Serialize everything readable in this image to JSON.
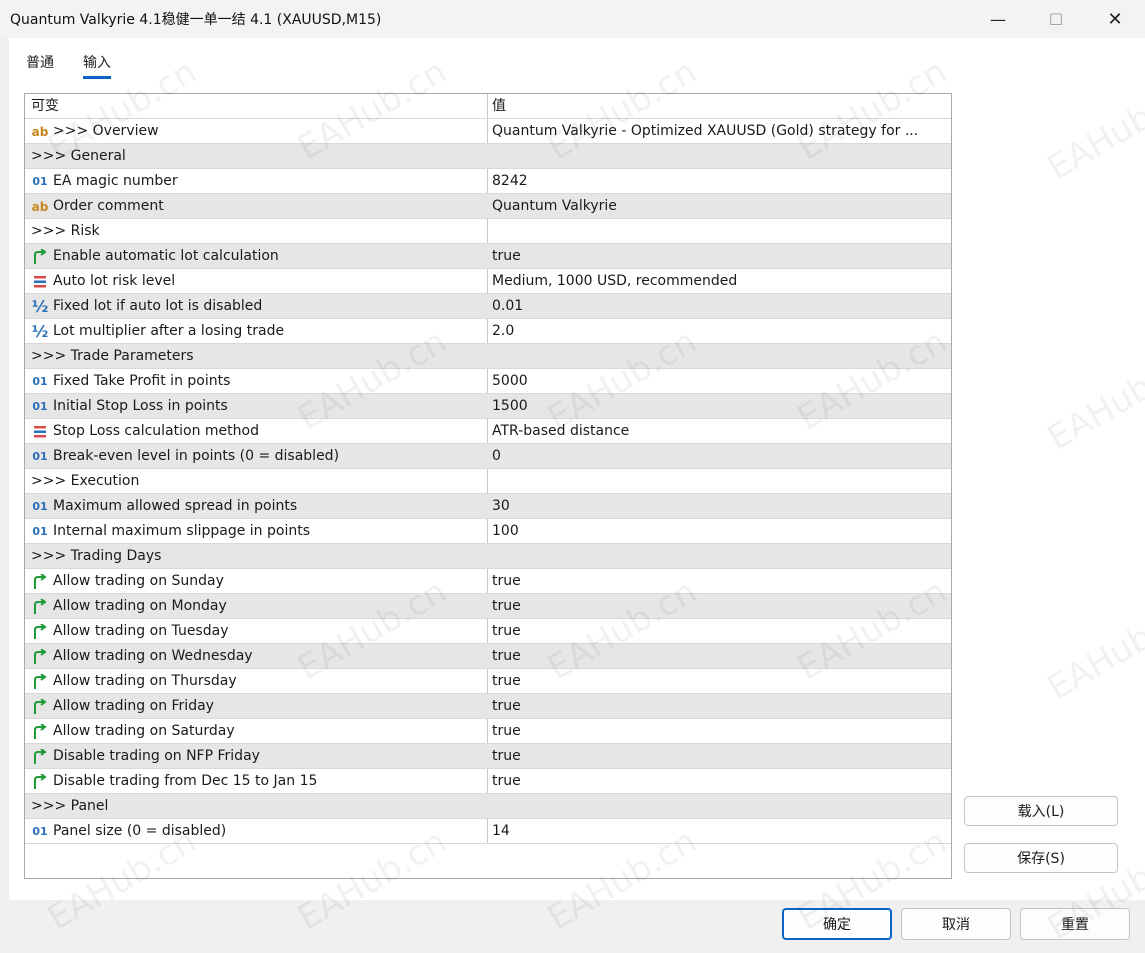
{
  "window": {
    "title": "Quantum Valkyrie 4.1稳健一单一结 4.1 (XAUUSD,M15)",
    "minimize_glyph": "—",
    "maximize_glyph": "☐",
    "close_glyph": "✕"
  },
  "tabs": [
    {
      "label": "普通",
      "active": false
    },
    {
      "label": "输入",
      "active": true
    }
  ],
  "grid": {
    "headers": [
      "可变",
      "值"
    ],
    "rows": [
      {
        "icon": "ab",
        "name": ">>> Overview",
        "value": "Quantum Valkyrie - Optimized XAUUSD (Gold) strategy for ..."
      },
      {
        "icon": "",
        "name": ">>> General",
        "value": ""
      },
      {
        "icon": "01",
        "name": "EA magic number",
        "value": "8242"
      },
      {
        "icon": "ab",
        "name": "Order comment",
        "value": "Quantum Valkyrie"
      },
      {
        "icon": "",
        "name": ">>> Risk",
        "value": ""
      },
      {
        "icon": "bool",
        "name": "Enable automatic lot calculation",
        "value": "true"
      },
      {
        "icon": "enum",
        "name": "Auto lot risk level",
        "value": "Medium, 1000 USD, recommended"
      },
      {
        "icon": "half",
        "name": "Fixed lot if auto lot is disabled",
        "value": "0.01"
      },
      {
        "icon": "half",
        "name": "Lot multiplier after a losing trade",
        "value": "2.0"
      },
      {
        "icon": "",
        "name": ">>> Trade Parameters",
        "value": ""
      },
      {
        "icon": "01",
        "name": "Fixed Take Profit in points",
        "value": "5000"
      },
      {
        "icon": "01",
        "name": "Initial Stop Loss in points",
        "value": "1500"
      },
      {
        "icon": "enum",
        "name": "Stop Loss calculation method",
        "value": "ATR-based distance"
      },
      {
        "icon": "01",
        "name": "Break-even level in points (0 = disabled)",
        "value": "0"
      },
      {
        "icon": "",
        "name": ">>> Execution",
        "value": ""
      },
      {
        "icon": "01",
        "name": "Maximum allowed spread in points",
        "value": "30"
      },
      {
        "icon": "01",
        "name": "Internal maximum slippage in points",
        "value": "100"
      },
      {
        "icon": "",
        "name": ">>> Trading Days",
        "value": ""
      },
      {
        "icon": "bool",
        "name": "Allow trading on Sunday",
        "value": "true"
      },
      {
        "icon": "bool",
        "name": "Allow trading on Monday",
        "value": "true"
      },
      {
        "icon": "bool",
        "name": "Allow trading on Tuesday",
        "value": "true"
      },
      {
        "icon": "bool",
        "name": "Allow trading on Wednesday",
        "value": "true"
      },
      {
        "icon": "bool",
        "name": "Allow trading on Thursday",
        "value": "true"
      },
      {
        "icon": "bool",
        "name": "Allow trading on Friday",
        "value": "true"
      },
      {
        "icon": "bool",
        "name": "Allow trading on Saturday",
        "value": "true"
      },
      {
        "icon": "bool",
        "name": "Disable trading on NFP Friday",
        "value": "true"
      },
      {
        "icon": "bool",
        "name": "Disable trading from Dec 15 to Jan 15",
        "value": "true"
      },
      {
        "icon": "",
        "name": ">>> Panel",
        "value": ""
      },
      {
        "icon": "01",
        "name": "Panel size (0 = disabled)",
        "value": "14"
      }
    ]
  },
  "side_buttons": {
    "load": "载入(L)",
    "save": "保存(S)"
  },
  "footer_buttons": {
    "ok": "确定",
    "cancel": "取消",
    "reset": "重置"
  },
  "watermark": "EAHub.cn",
  "colors": {
    "accent": "#0a64c8",
    "row_alt": "#e6e6e6",
    "bool_icon": "#1f9b3a",
    "num_icon": "#2a6fb8",
    "str_icon": "#c8861e",
    "enum_icon": "#d84a4a"
  }
}
